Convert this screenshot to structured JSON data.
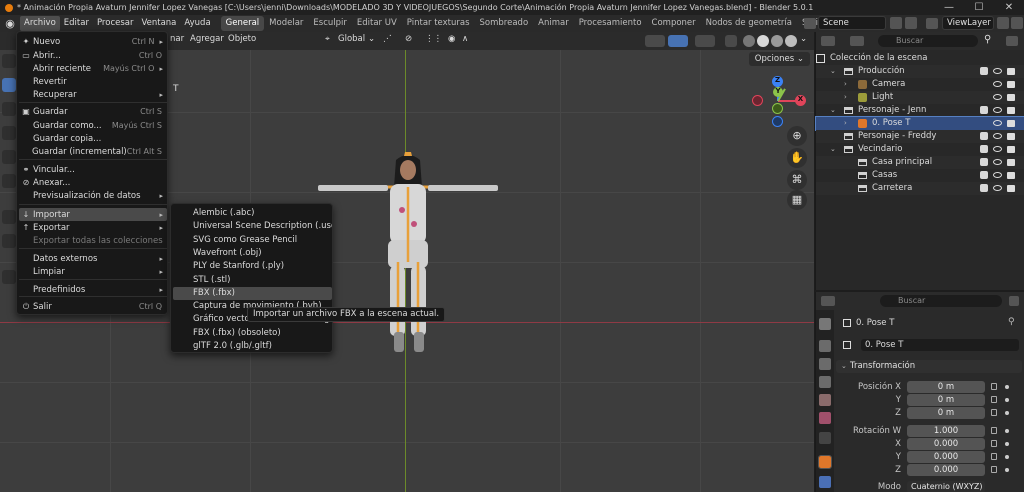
{
  "window": {
    "title": "* Animación Propia Avaturn Jennifer Lopez Vanegas [C:\\Users\\jenni\\Downloads\\MODELADO 3D Y VIDEOJUEGOS\\Segundo Corte\\Animación Propia Avaturn Jennifer Lopez Vanegas.blend] - Blender 5.0.1",
    "controls": [
      "—",
      "☐",
      "✕"
    ]
  },
  "menubar": {
    "items": [
      "Archivo",
      "Editar",
      "Procesar",
      "Ventana",
      "Ayuda"
    ],
    "workspaces": [
      "General",
      "Modelar",
      "Esculpir",
      "Editar UV",
      "Pintar texturas",
      "Sombreado",
      "Animar",
      "Procesamiento",
      "Componer",
      "Nodos de geometría",
      "Scripts"
    ],
    "scene": "Scene",
    "view_layer": "ViewLayer"
  },
  "viewport": {
    "header_menus": [
      "nar",
      "Agregar",
      "Objeto"
    ],
    "transform_orientation": "Global",
    "options": "Opciones",
    "axis_label": "T",
    "gizmo": {
      "z": "Z",
      "y": "Y",
      "x": "X"
    }
  },
  "file_menu": {
    "items": [
      {
        "icon": "✦",
        "label": "Nuevo",
        "shortcut": "Ctrl N",
        "arrow": "▸"
      },
      {
        "icon": "▭",
        "label": "Abrir...",
        "shortcut": "Ctrl O"
      },
      {
        "icon": "",
        "label": "Abrir reciente",
        "shortcut": "Mayús Ctrl O",
        "arrow": "▸"
      },
      {
        "icon": "",
        "label": "Revertir",
        "shortcut": ""
      },
      {
        "icon": "",
        "label": "Recuperar",
        "shortcut": "",
        "arrow": "▸"
      },
      {
        "icon": "▣",
        "label": "Guardar",
        "shortcut": "Ctrl S"
      },
      {
        "icon": "",
        "label": "Guardar como...",
        "shortcut": "Mayús Ctrl S"
      },
      {
        "icon": "",
        "label": "Guardar copia...",
        "shortcut": ""
      },
      {
        "icon": "",
        "label": "Guardar (incremental)",
        "shortcut": "Ctrl Alt S"
      },
      {
        "icon": "⚭",
        "label": "Vincular...",
        "shortcut": ""
      },
      {
        "icon": "⊘",
        "label": "Anexar...",
        "shortcut": ""
      },
      {
        "icon": "",
        "label": "Previsualización de datos",
        "shortcut": "",
        "arrow": "▸"
      },
      {
        "icon": "↓",
        "label": "Importar",
        "shortcut": "",
        "arrow": "▸"
      },
      {
        "icon": "↑",
        "label": "Exportar",
        "shortcut": "",
        "arrow": "▸"
      },
      {
        "icon": "",
        "label": "Exportar todas las colecciones",
        "shortcut": ""
      },
      {
        "icon": "",
        "label": "Datos externos",
        "shortcut": "",
        "arrow": "▸"
      },
      {
        "icon": "",
        "label": "Limpiar",
        "shortcut": "",
        "arrow": "▸"
      },
      {
        "icon": "",
        "label": "Predefinidos",
        "shortcut": "",
        "arrow": "▸"
      },
      {
        "icon": "⏻",
        "label": "Salir",
        "shortcut": "Ctrl Q"
      }
    ]
  },
  "import_menu": {
    "items": [
      "Alembic (.abc)",
      "Universal Scene Description (.usd*)",
      "SVG como Grease Pencil",
      "Wavefront (.obj)",
      "PLY de Stanford (.ply)",
      "STL (.stl)",
      "FBX (.fbx)",
      "Captura de movimiento (.bvh)",
      "Gráfico vectorial escalable (.svg)",
      "FBX (.fbx) (obsoleto)",
      "glTF 2.0 (.glb/.gltf)"
    ],
    "tooltip": "Importar un archivo FBX a la escena actual."
  },
  "outliner": {
    "search_placeholder": "Buscar",
    "rows": [
      {
        "label": "Colección de la escena"
      },
      {
        "label": "Producción"
      },
      {
        "label": "Camera"
      },
      {
        "label": "Light"
      },
      {
        "label": "Personaje - Jenn"
      },
      {
        "label": "0. Pose T"
      },
      {
        "label": "Personaje - Freddy"
      },
      {
        "label": "Vecindario"
      },
      {
        "label": "Casa principal"
      },
      {
        "label": "Casas"
      },
      {
        "label": "Carretera"
      }
    ]
  },
  "properties": {
    "search_placeholder": "Buscar",
    "object_name": "0. Pose T",
    "object_field": "0. Pose T",
    "panel": "Transformación",
    "location": {
      "label": "Posición X",
      "x": "0 m",
      "y": "0 m",
      "z": "0 m",
      "y_label": "Y",
      "z_label": "Z"
    },
    "rotation": {
      "label": "Rotación W",
      "w": "1.000",
      "x": "0.000",
      "y": "0.000",
      "z": "0.000",
      "x_label": "X",
      "y_label": "Y",
      "z_label": "Z"
    },
    "mode": {
      "label": "Modo",
      "value": "Cuaternio (WXYZ)"
    }
  },
  "colors": {
    "accent": "#4772b3",
    "selected_row": "#334d80",
    "axis_x": "#e0445a",
    "axis_y": "#8bc34a",
    "axis_z": "#3b82f6"
  }
}
